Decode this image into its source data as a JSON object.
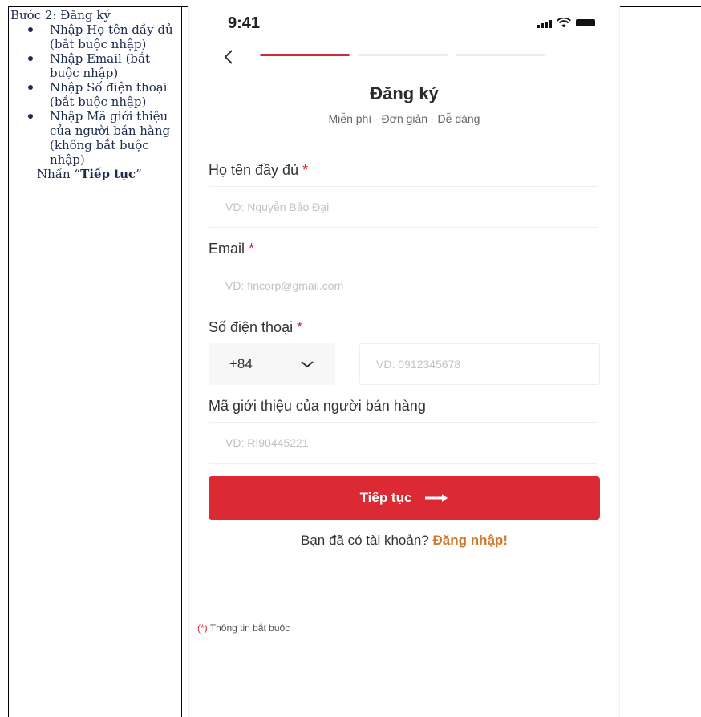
{
  "instructions": {
    "title": "Bước 2:  Đăng ký",
    "items": [
      "Nhập Họ tên đầy đủ (bắt buộc nhập)",
      "Nhập Email (bắt buộc nhập)",
      "Nhập Số điện thoại (bắt buộc nhập)",
      "Nhập Mã giới thiệu của người bán hàng (không bắt buộc nhập)"
    ],
    "press_prefix": "Nhấn “",
    "press_action": "Tiếp tục",
    "press_suffix": "”"
  },
  "status_bar": {
    "time": "9:41",
    "icons": [
      "signal-icon",
      "wifi-icon",
      "battery-icon"
    ]
  },
  "nav": {
    "back_icon": "chevron-left-icon",
    "progress": {
      "steps": 3,
      "current": 1
    }
  },
  "header": {
    "title": "Đăng ký",
    "subtitle": "Miễn phí - Đơn giản - Dễ dàng"
  },
  "form": {
    "full_name": {
      "label": "Họ tên đầy đủ",
      "required_mark": "*",
      "placeholder": "VD: Nguyễn Bảo Đại"
    },
    "email": {
      "label": "Email",
      "required_mark": "*",
      "placeholder": "VD: fincorp@gmail.com"
    },
    "phone": {
      "label": "Số điện thoại",
      "required_mark": "*",
      "country_code": "+84",
      "placeholder": "VD: 0912345678"
    },
    "referral": {
      "label": "Mã giới thiệu của người bán hàng",
      "placeholder": "VD: RI90445221"
    }
  },
  "submit": {
    "label": "Tiếp tục",
    "icon": "arrow-right-icon"
  },
  "login_prompt": {
    "text": "Bạn đã có tài khoản? ",
    "link": "Đăng nhập!"
  },
  "footnote": {
    "mark": "(*)",
    "text": " Thông tin bắt buộc"
  },
  "colors": {
    "accent": "#dc2a34",
    "link": "#cf7a2d",
    "placeholder": "#c2c2c2"
  }
}
